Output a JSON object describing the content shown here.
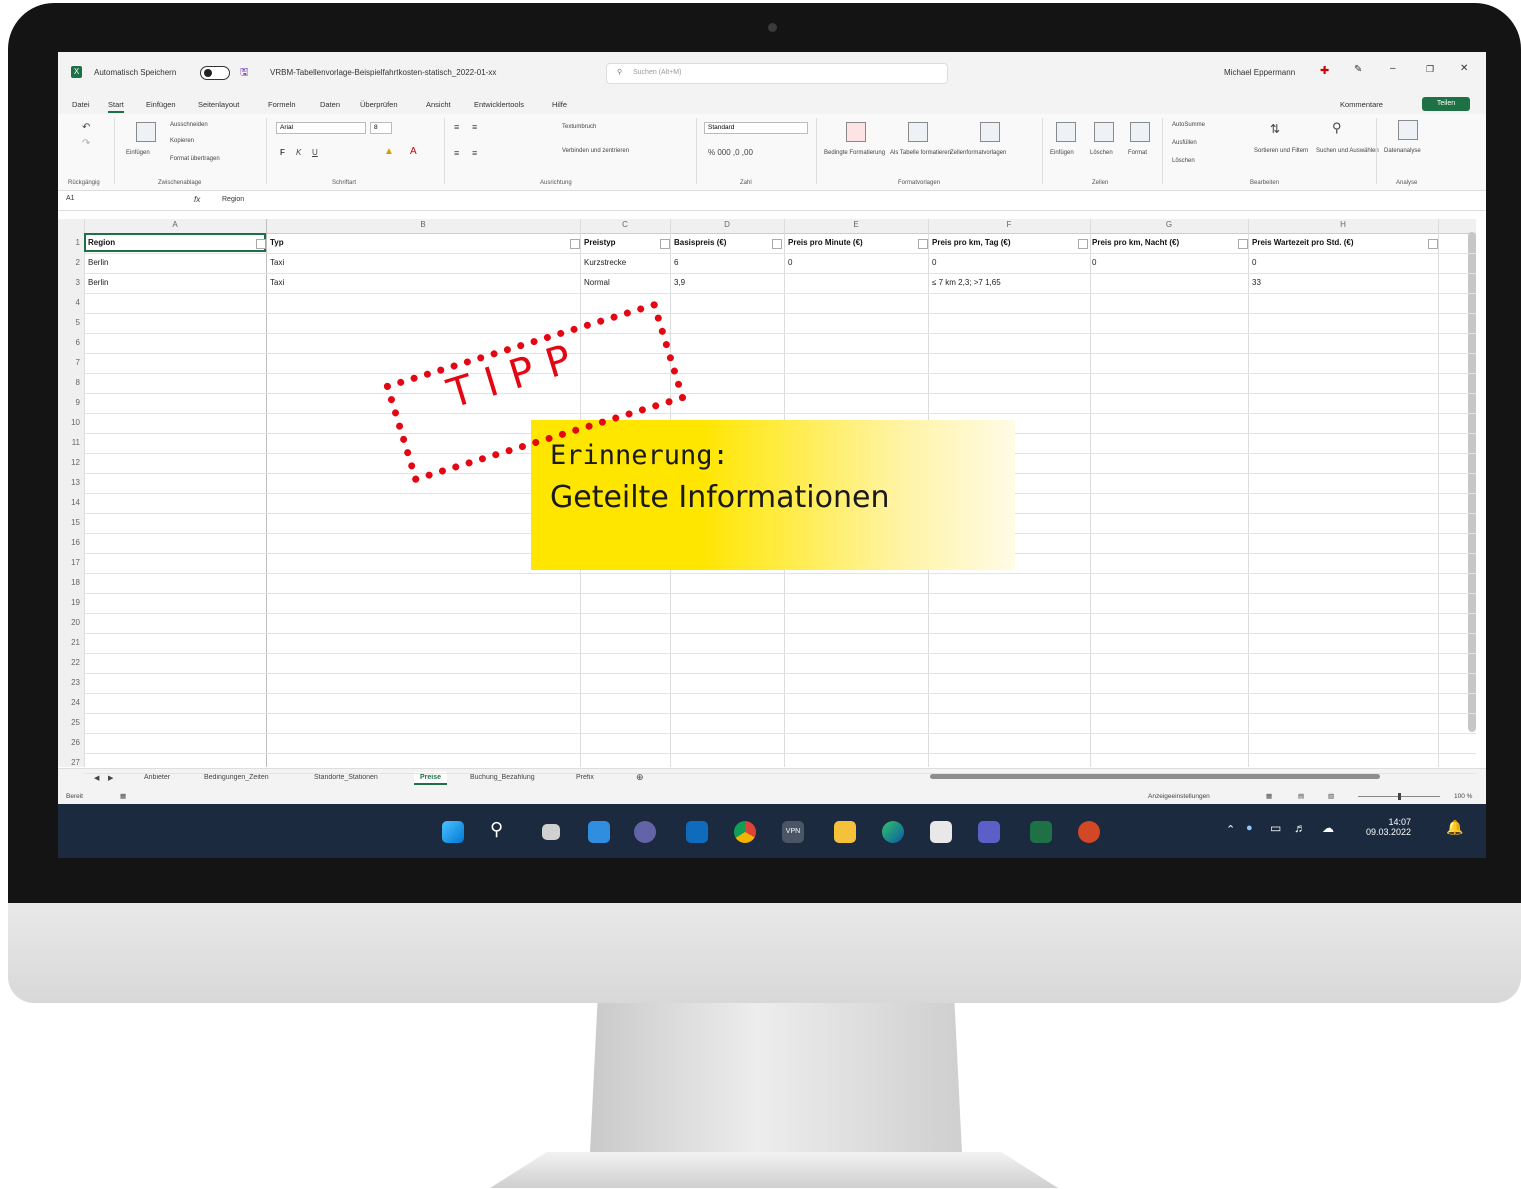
{
  "titlebar": {
    "autosave_label": "Automatisch Speichern",
    "file_name": "VRBM-Tabellenvorlage-Beispielfahrtkosten-statisch_2022-01-xx",
    "search_placeholder": "Suchen (Alt+M)",
    "user_name": "Michael Eppermann"
  },
  "menu": {
    "items": [
      "Datei",
      "Start",
      "Einfügen",
      "Seitenlayout",
      "Formeln",
      "Daten",
      "Überprüfen",
      "Ansicht",
      "Entwicklertools",
      "Hilfe"
    ],
    "comments_label": "Kommentare",
    "share_label": "Teilen"
  },
  "ribbon": {
    "groups": [
      "Rückgängig",
      "Zwischenablage",
      "Schriftart",
      "Ausrichtung",
      "Zahl",
      "Formatvorlagen",
      "Zellen",
      "Bearbeiten",
      "Analyse"
    ],
    "paste_label": "Einfügen",
    "cut_label": "Ausschneiden",
    "copy_label": "Kopieren",
    "format_painter_label": "Format übertragen",
    "font_name": "Arial",
    "font_size": "8",
    "wrap_label": "Textumbruch",
    "merge_label": "Verbinden und zentrieren",
    "number_format": "Standard",
    "conditional_label": "Bedingte Formatierung",
    "table_label": "Als Tabelle formatieren",
    "cellstyles_label": "Zellenformatvorlagen",
    "insert_label": "Einfügen",
    "delete_label": "Löschen",
    "format_label": "Format",
    "autosum_label": "AutoSumme",
    "fill_label": "Ausfüllen",
    "clear_label": "Löschen",
    "sort_label": "Sortieren und Filtern",
    "find_label": "Suchen und Auswählen",
    "analyze_label": "Datenanalyse"
  },
  "formula_bar": {
    "name_box": "A1",
    "fx": "fx",
    "content": "Region"
  },
  "sheet": {
    "columns": [
      "A",
      "B",
      "C",
      "D",
      "E",
      "F",
      "G",
      "H"
    ],
    "headers": [
      "Region",
      "Typ",
      "Preistyp",
      "Basispreis (€)",
      "Preis pro Minute (€)",
      "Preis pro km, Tag (€)",
      "Preis pro km, Nacht (€)",
      "Preis Wartezeit pro Std. (€)"
    ],
    "rows": [
      [
        "Berlin",
        "Taxi",
        "Kurzstrecke",
        "6",
        "0",
        "0",
        "0",
        "0"
      ],
      [
        "Berlin",
        "Taxi",
        "Normal",
        "3,9",
        "",
        "≤ 7 km 2,3; >7 1,65",
        "",
        "33"
      ]
    ],
    "row_numbers": [
      "1",
      "2",
      "3",
      "4",
      "5",
      "6",
      "7",
      "8",
      "9",
      "10",
      "11",
      "12",
      "13",
      "14",
      "15",
      "16",
      "17",
      "18",
      "19",
      "20",
      "21",
      "22",
      "23",
      "24",
      "25",
      "26",
      "27"
    ]
  },
  "tabs": {
    "items": [
      "Anbieter",
      "Bedingungen_Zeiten",
      "Standorte_Stationen",
      "Preise",
      "Buchung_Bezahlung",
      "Prefix"
    ],
    "active": "Preise"
  },
  "status": {
    "ready": "Bereit",
    "display_settings": "Anzeigeeinstellungen",
    "zoom": "100 %"
  },
  "taskbar": {
    "time": "14:07",
    "date": "09.03.2022",
    "vpn_label": "VPN"
  },
  "overlay": {
    "stamp": "TIPP",
    "line1": "Erinnerung:",
    "line2": "Geteilte Informationen"
  }
}
